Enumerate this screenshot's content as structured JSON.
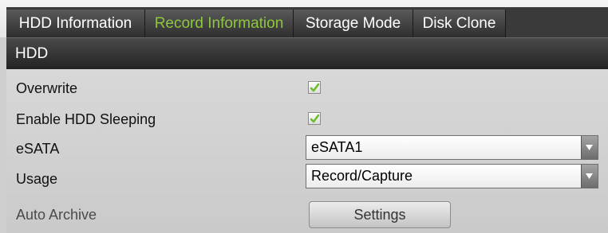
{
  "tabs": [
    {
      "label": "HDD Information",
      "active": false
    },
    {
      "label": "Record Information",
      "active": true
    },
    {
      "label": "Storage Mode",
      "active": false
    },
    {
      "label": "Disk Clone",
      "active": false
    }
  ],
  "section": {
    "title": "HDD"
  },
  "settings": {
    "overwrite": {
      "label": "Overwrite",
      "checked": true
    },
    "hdd_sleeping": {
      "label": "Enable HDD Sleeping",
      "checked": true
    },
    "esata": {
      "label": "eSATA",
      "value": "eSATA1"
    },
    "usage": {
      "label": "Usage",
      "value": "Record/Capture"
    },
    "auto_archive": {
      "label": "Auto Archive",
      "button_label": "Settings"
    }
  },
  "colors": {
    "active_tab_text": "#8ec63f",
    "checkmark": "#6cbf2f"
  },
  "icons": [
    "checkmark-icon",
    "dropdown-arrow-icon"
  ]
}
